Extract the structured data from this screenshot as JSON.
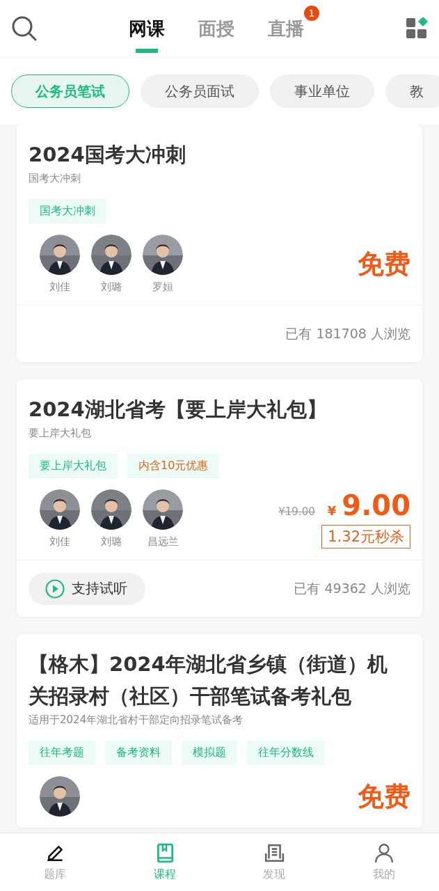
{
  "tabs": [
    {
      "label": "网课",
      "selected": true
    },
    {
      "label": "面授",
      "selected": false
    },
    {
      "label": "直播",
      "selected": false,
      "badge": "1"
    }
  ],
  "chips": [
    {
      "label": "公务员笔试",
      "selected": true
    },
    {
      "label": "公务员面试",
      "selected": false
    },
    {
      "label": "事业单位",
      "selected": false
    },
    {
      "label": "教",
      "selected": false
    }
  ],
  "courses": [
    {
      "title": "2024国考大冲刺",
      "subtitle": "国考大冲刺",
      "tags": [
        {
          "label": "国考大冲刺",
          "kind": "green"
        }
      ],
      "teachers": [
        {
          "kind": "picture",
          "name": "刘佳"
        },
        {
          "kind": "picture",
          "name": "刘璐"
        },
        {
          "kind": "picture",
          "name": "罗姮"
        }
      ],
      "price": {
        "kind": "free",
        "text": "免费"
      },
      "views": "已有 181708 人浏览"
    },
    {
      "title": "2024湖北省考【要上岸大礼包】",
      "subtitle": "要上岸大礼包",
      "tags": [
        {
          "label": "要上岸大礼包",
          "kind": "green"
        },
        {
          "label": "内含10元优惠",
          "kind": "orange"
        }
      ],
      "teachers": [
        {
          "kind": "picture",
          "name": "刘佳"
        },
        {
          "kind": "picture",
          "name": "刘璐"
        },
        {
          "kind": "picture",
          "name": "昌远兰"
        }
      ],
      "price": {
        "kind": "paid",
        "original": "¥19.00",
        "currency": "¥",
        "amount": "9.00",
        "flash": "1.32元秒杀"
      },
      "trial": "支持试听",
      "views": "已有 49362 人浏览"
    },
    {
      "title": "【格木】2024年湖北省乡镇（街道）机关招录村（社区）干部笔试备考礼包",
      "subtitle": "适用于2024年湖北省村干部定向招录笔试备考",
      "tags": [
        {
          "label": "往年考题",
          "kind": "green"
        },
        {
          "label": "备考资料",
          "kind": "green"
        },
        {
          "label": "模拟题",
          "kind": "green"
        },
        {
          "label": "往年分数线",
          "kind": "green"
        }
      ],
      "price": {
        "kind": "free",
        "text": "免费"
      }
    }
  ],
  "nav": [
    {
      "label": "题库",
      "kind": "pencil",
      "selected": false
    },
    {
      "label": "课程",
      "kind": "book",
      "selected": true
    },
    {
      "label": "发现",
      "kind": "document",
      "selected": false
    },
    {
      "label": "我的",
      "kind": "person",
      "selected": false
    }
  ]
}
